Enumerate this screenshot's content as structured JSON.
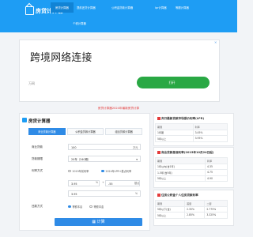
{
  "brand": {
    "logo_text": "房贷计算器"
  },
  "nav": {
    "items": [
      "房贷计算器",
      "提前还贷计算器",
      "公积金贷款计算器",
      "lpr计算器",
      "等额计算器",
      "个税计算器"
    ],
    "active_index": 0
  },
  "ad": {
    "title": "跨境网络连接",
    "subtitle": "万网",
    "button_label": "打开",
    "close_label": "×"
  },
  "notice": "房贷计算器2024年最新房贷计算",
  "calculator": {
    "title": "房贷计算器",
    "tabs": [
      "商业贷款计算器",
      "公积金贷款计算器",
      "组合贷款计算器"
    ],
    "active_tab": 0,
    "labels": {
      "amount": "商业贷款",
      "years": "贷款期限",
      "rate_type": "利率方式",
      "method": "还款方式"
    },
    "amount_value": "100",
    "amount_unit": "万元",
    "years_value": "20年（240期）",
    "rate_options": [
      "2019年前利率",
      "2024年LPR+基点利率"
    ],
    "lpr_value": "3.95",
    "lpr_unit": "%",
    "bp_value": "-55",
    "bp_unit": "基点",
    "result_rate": "3.95",
    "result_unit": "%",
    "method_options": [
      "等额本息",
      "等额本金"
    ],
    "button_label": "计算"
  },
  "sidebar": {
    "lpr": {
      "title": "央行最新贷款市场报价利率(LPR)",
      "headers": [
        "期限",
        "利率"
      ],
      "rows": [
        [
          "1年期",
          "3.45%"
        ],
        [
          "5年以上",
          "3.95%"
        ]
      ]
    },
    "base": {
      "title": "商业贷款基准利率(2015年10月24日起)",
      "headers": [
        "期限",
        "利率"
      ],
      "rows": [
        [
          "1年以内(含1年)",
          "4.35"
        ],
        [
          "1-5年(含5年)",
          "4.75"
        ],
        [
          "5年以上",
          "4.90"
        ]
      ]
    },
    "fund": {
      "title": "住房公积金个人住房贷款利率",
      "headers": [
        "期限",
        "首套",
        "二套"
      ],
      "rows": [
        [
          "5年以下(含)",
          "2.35%",
          "2.775%"
        ],
        [
          "5年以上",
          "2.85%",
          "3.325%"
        ]
      ]
    }
  },
  "colors": {
    "primary": "#1e9df4",
    "accent_green": "#29a844",
    "accent_red": "#e43a3a"
  }
}
